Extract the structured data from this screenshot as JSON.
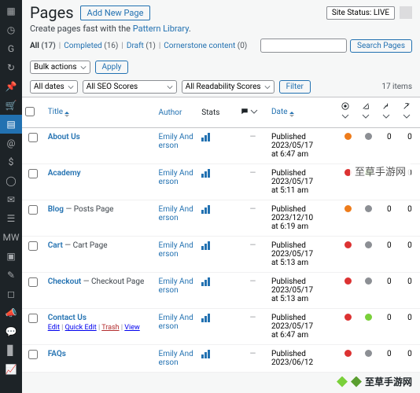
{
  "sidebar": {
    "items": [
      {
        "icon": "grid"
      },
      {
        "icon": "gauge"
      },
      {
        "icon": "g"
      },
      {
        "icon": "refresh"
      },
      {
        "icon": "pin"
      },
      {
        "icon": "cart"
      },
      {
        "icon": "page",
        "active": true
      },
      {
        "icon": "at"
      },
      {
        "icon": "dollar"
      },
      {
        "icon": "circle"
      },
      {
        "icon": "mail"
      },
      {
        "icon": "list"
      },
      {
        "icon": "mw"
      },
      {
        "icon": "layers"
      },
      {
        "icon": "pencil"
      },
      {
        "icon": "square"
      },
      {
        "icon": "megaphone"
      },
      {
        "icon": "comment"
      },
      {
        "icon": "chart"
      },
      {
        "icon": "trend"
      }
    ]
  },
  "header": {
    "title": "Pages",
    "add_new": "Add New Page",
    "site_status_label": "Site Status:",
    "site_status_value": "LIVE"
  },
  "subtitle": {
    "text_prefix": "Create pages fast with the ",
    "link": "Pattern Library",
    "text_suffix": "."
  },
  "views": [
    {
      "label": "All",
      "count": "(17)",
      "bold": true
    },
    {
      "label": "Completed",
      "count": "(16)"
    },
    {
      "label": "Draft",
      "count": "(1)"
    },
    {
      "label": "Cornerstone content",
      "count": "(0)"
    }
  ],
  "search": {
    "placeholder": "",
    "button": "Search Pages"
  },
  "bulk": {
    "label": "Bulk actions",
    "apply": "Apply"
  },
  "filters": {
    "dates": "All dates",
    "seo": "All SEO Scores",
    "readability": "All Readability Scores",
    "filter_btn": "Filter",
    "items": "17 items"
  },
  "columns": {
    "title": "Title",
    "author": "Author",
    "stats": "Stats",
    "date": "Date"
  },
  "row_actions": {
    "edit": "Edit",
    "quick": "Quick Edit",
    "trash": "Trash",
    "view": "View"
  },
  "rows": [
    {
      "title": "About Us",
      "suffix": "",
      "author": "Emily Anderson",
      "comments": "—",
      "status": "Published",
      "date": "2023/05/17",
      "time": "at 6:47 am",
      "seo": "orange",
      "read": "gray",
      "links": "0",
      "wc": "0",
      "actions": false
    },
    {
      "title": "Academy",
      "suffix": "",
      "author": "Emily Anderson",
      "comments": "—",
      "status": "Published",
      "date": "2023/05/17",
      "time": "at 5:11 am",
      "seo": "red",
      "read": "green",
      "links": "0",
      "wc": "0",
      "actions": false
    },
    {
      "title": "Blog",
      "suffix": " — Posts Page",
      "author": "Emily Anderson",
      "comments": "—",
      "status": "Published",
      "date": "2023/12/10",
      "time": "at 6:19 am",
      "seo": "orange",
      "read": "gray",
      "links": "0",
      "wc": "0",
      "actions": false
    },
    {
      "title": "Cart",
      "suffix": " — Cart Page",
      "author": "Emily Anderson",
      "comments": "—",
      "status": "Published",
      "date": "2023/05/17",
      "time": "at 5:13 am",
      "seo": "red",
      "read": "gray",
      "links": "0",
      "wc": "0",
      "actions": false
    },
    {
      "title": "Checkout",
      "suffix": " — Checkout Page",
      "author": "Emily Anderson",
      "comments": "—",
      "status": "Published",
      "date": "2023/05/17",
      "time": "at 5:13 am",
      "seo": "red",
      "read": "gray",
      "links": "0",
      "wc": "0",
      "actions": false
    },
    {
      "title": "Contact Us",
      "suffix": "",
      "author": "Emily Anderson",
      "comments": "—",
      "status": "Published",
      "date": "2023/05/17",
      "time": "at 6:47 am",
      "seo": "red",
      "read": "green",
      "links": "0",
      "wc": "0",
      "actions": true
    },
    {
      "title": "FAQs",
      "suffix": "",
      "author": "Emily Anderson",
      "comments": "—",
      "status": "Published",
      "date": "2023/06/12",
      "time": "",
      "seo": "red",
      "read": "gray",
      "links": "0",
      "wc": "0",
      "actions": false
    }
  ],
  "watermark": "至草手游网",
  "brand": "至草手游网"
}
